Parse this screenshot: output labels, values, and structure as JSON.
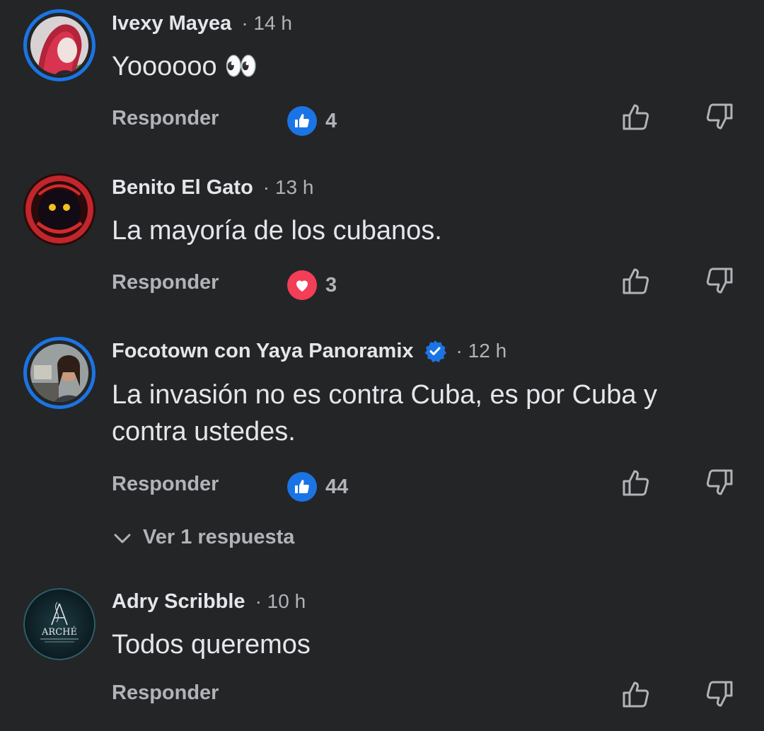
{
  "comments": [
    {
      "author": "Ivexy Mayea",
      "time": "· 14 h",
      "text": "Yoooooo 👀",
      "reply_label": "Responder",
      "reaction_type": "like",
      "reaction_count": "4"
    },
    {
      "author": "Benito El Gato",
      "time": "· 13 h",
      "text": "La mayoría de los cubanos.",
      "reply_label": "Responder",
      "reaction_type": "love",
      "reaction_count": "3"
    },
    {
      "author": "Focotown con Yaya Panoramix",
      "verified": true,
      "time": "· 12 h",
      "text": "La invasión no es contra Cuba, es por Cuba y contra ustedes.",
      "reply_label": "Responder",
      "reaction_type": "like",
      "reaction_count": "44",
      "view_replies_label": "Ver 1 respuesta"
    },
    {
      "author": "Adry Scribble",
      "time": "· 10 h",
      "text": "Todos queremos",
      "reply_label": "Responder",
      "avatar_logo_text": "ARCHÉ"
    }
  ],
  "colors": {
    "background": "#242526",
    "text_primary": "#e4e6eb",
    "text_secondary": "#b0b3b8",
    "like_blue": "#1b74e4",
    "love_red": "#f33e58",
    "verified_blue": "#1b74e4",
    "story_ring": "#1b74e4"
  },
  "icons": {
    "like_reaction": "thumbs-up-reaction-icon",
    "love_reaction": "heart-reaction-icon",
    "upvote": "thumbs-up-outline-icon",
    "downvote": "thumbs-down-outline-icon",
    "verified": "verified-badge-icon",
    "expand": "chevron-down-icon"
  }
}
